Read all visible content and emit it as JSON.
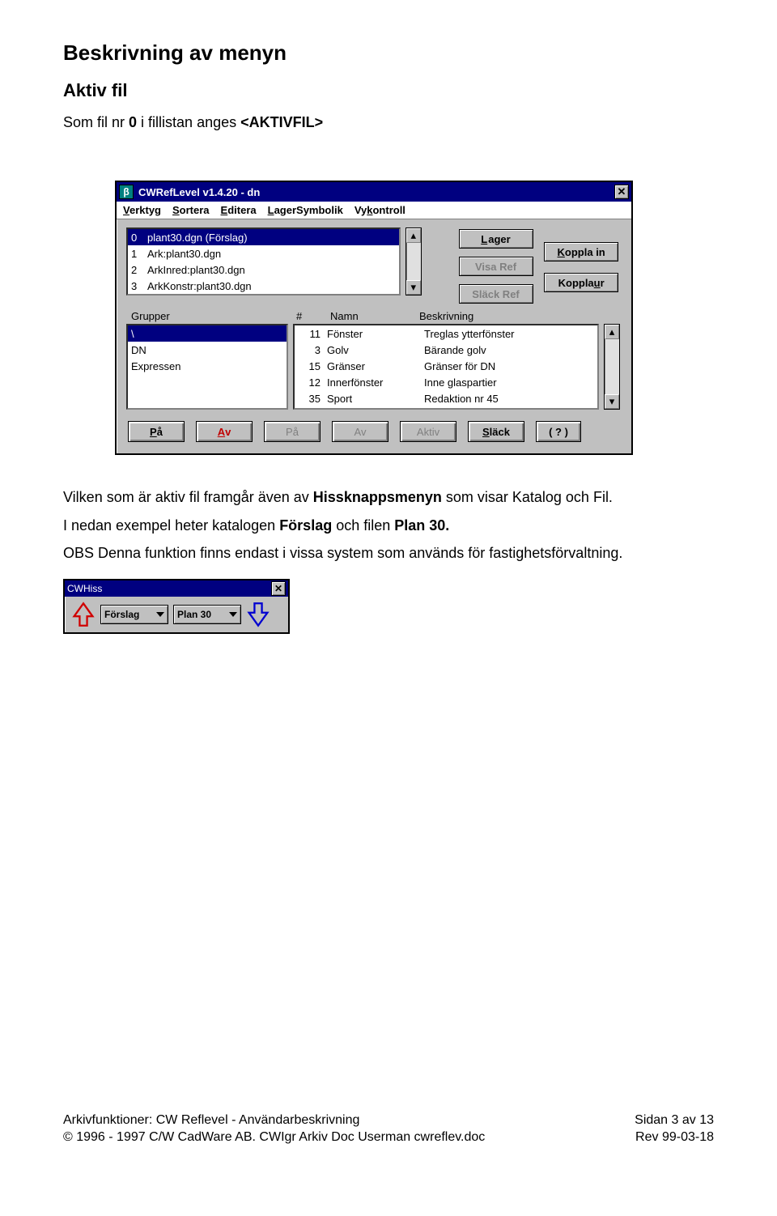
{
  "heading": "Beskrivning av menyn",
  "subheading": "Aktiv fil",
  "intro": {
    "p1a": "Som fil nr ",
    "p1b": "0",
    "p1c": " i fillistan anges ",
    "p1d": "<AKTIVFIL>"
  },
  "dialog": {
    "title": "CWRefLevel v1.4.20   -   dn",
    "menu": [
      "Verktyg",
      "Sortera",
      "Editera",
      "LagerSymbolik",
      "Vykontroll"
    ],
    "files": [
      {
        "n": "0",
        "name": "plant30.dgn  (Förslag)",
        "sel": true
      },
      {
        "n": "1",
        "name": "Ark:plant30.dgn",
        "sel": false
      },
      {
        "n": "2",
        "name": "ArkInred:plant30.dgn",
        "sel": false
      },
      {
        "n": "3",
        "name": "ArkKonstr:plant30.dgn",
        "sel": false
      }
    ],
    "btn_lager": "Lager",
    "btn_visaref": "Visa Ref",
    "btn_slackref": "Släck Ref",
    "btn_kopplain": "Koppla in",
    "btn_kopplaut": "Koppla ur",
    "col_grupper": "Grupper",
    "col_num": "#",
    "col_namn": "Namn",
    "col_beskr": "Beskrivning",
    "groups": [
      {
        "name": "\\",
        "sel": true
      },
      {
        "name": "DN",
        "sel": false
      },
      {
        "name": "Expressen",
        "sel": false
      }
    ],
    "details": [
      {
        "n": "11",
        "name": "Fönster",
        "desc": "Treglas ytterfönster"
      },
      {
        "n": "3",
        "name": "Golv",
        "desc": "Bärande golv"
      },
      {
        "n": "15",
        "name": "Gränser",
        "desc": "Gränser för DN"
      },
      {
        "n": "12",
        "name": "Innerfönster",
        "desc": "Inne glaspartier"
      },
      {
        "n": "35",
        "name": "Sport",
        "desc": "Redaktion nr 45"
      }
    ],
    "btns": {
      "pa": "På",
      "av": "Av",
      "pa2": "På",
      "av2": "Av",
      "aktiv": "Aktiv",
      "slack": "Släck",
      "help": "( ? )"
    }
  },
  "after": {
    "p2a": "Vilken som är aktiv fil framgår även av ",
    "p2b": "Hissknappsmenyn",
    "p2c": " som visar Katalog och Fil.",
    "p3a": "I nedan exempel heter katalogen ",
    "p3b": "Förslag",
    "p3c": " och filen ",
    "p3d": "Plan 30.",
    "p4": "OBS Denna funktion finns endast i vissa system som används för fastighetsförvaltning."
  },
  "hiss": {
    "title": "CWHiss",
    "left": "Förslag",
    "right": "Plan 30"
  },
  "footer": {
    "l1": "Arkivfunktioner: CW Reflevel - Användarbeskrivning",
    "l2": "© 1996 - 1997 C/W CadWare AB. CWIgr Arkiv Doc Userman cwreflev.doc",
    "r1": "Sidan 3 av 13",
    "r2": "Rev 99-03-18"
  }
}
